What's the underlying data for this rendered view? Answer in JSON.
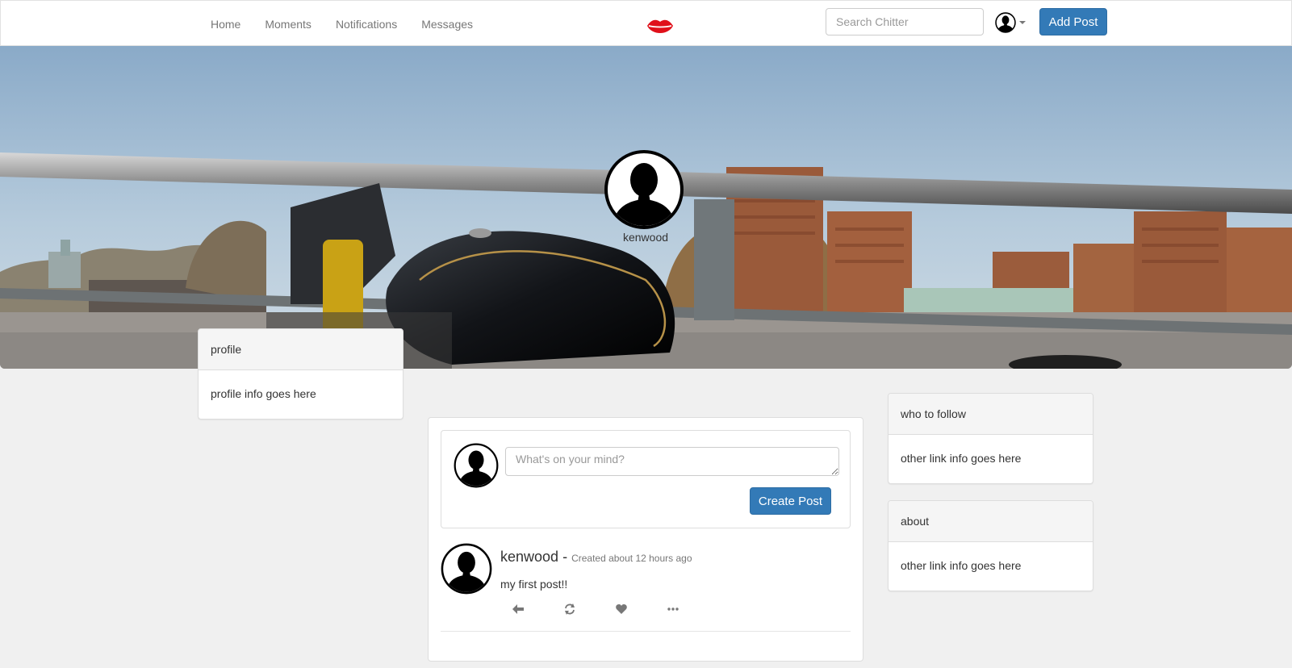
{
  "navbar": {
    "links": [
      "Home",
      "Moments",
      "Notifications",
      "Messages"
    ],
    "logo_icon": "lips-icon",
    "search_placeholder": "Search Chitter",
    "user_icon": "user-avatar-icon",
    "add_post_label": "Add Post"
  },
  "banner": {
    "username": "kenwood"
  },
  "profile_panel": {
    "heading": "profile",
    "body": "profile info goes here"
  },
  "composer": {
    "placeholder": "What's on your mind?",
    "submit_label": "Create Post"
  },
  "post": {
    "author": "kenwood",
    "separator": " - ",
    "time": "Created about 12 hours ago",
    "text": "my first post!!",
    "actions": [
      "reply-icon",
      "retweet-icon",
      "heart-icon",
      "more-icon"
    ]
  },
  "follow_panel": {
    "heading": "who to follow",
    "body": "other link info goes here"
  },
  "about_panel": {
    "heading": "about",
    "body": "other link info goes here"
  },
  "colors": {
    "primary": "#337ab7",
    "logo": "#e0101a",
    "background": "#f0f0f0"
  }
}
